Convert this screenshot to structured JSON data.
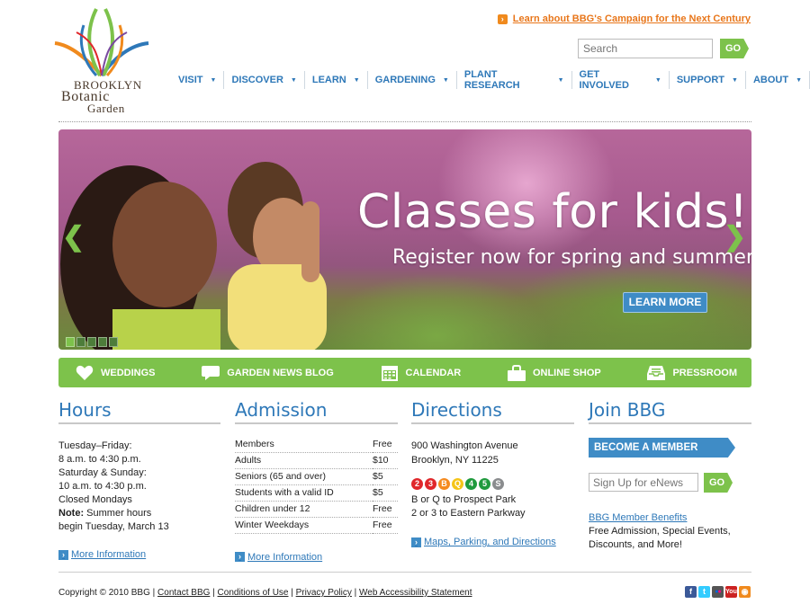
{
  "logo": {
    "line1": "Brooklyn",
    "line2": "Botanic",
    "line3": "Garden"
  },
  "header": {
    "campaign_link": "Learn about BBG's Campaign for the Next Century",
    "search_placeholder": "Search",
    "search_button": "GO"
  },
  "nav": [
    {
      "label": "VISIT"
    },
    {
      "label": "DISCOVER"
    },
    {
      "label": "LEARN"
    },
    {
      "label": "GARDENING"
    },
    {
      "label": "PLANT RESEARCH"
    },
    {
      "label": "GET INVOLVED"
    },
    {
      "label": "SUPPORT"
    },
    {
      "label": "ABOUT"
    }
  ],
  "hero": {
    "title": "Classes for kids!",
    "subtitle": "Register now for spring and summer.",
    "button": "LEARN MORE",
    "slides": 5,
    "active_slide": 1
  },
  "quicklinks": [
    {
      "label": "WEDDINGS",
      "icon": "heart-icon"
    },
    {
      "label": "GARDEN NEWS BLOG",
      "icon": "speech-bubble-icon"
    },
    {
      "label": "CALENDAR",
      "icon": "calendar-icon"
    },
    {
      "label": "ONLINE SHOP",
      "icon": "shopping-bag-icon"
    },
    {
      "label": "PRESSROOM",
      "icon": "inbox-tray-icon"
    }
  ],
  "hours": {
    "title": "Hours",
    "lines": [
      "Tuesday–Friday:",
      "8 a.m. to 4:30 p.m.",
      "Saturday & Sunday:",
      "10 a.m. to 4:30 p.m.",
      "Closed Mondays"
    ],
    "note_label": "Note:",
    "note_text": " Summer hours",
    "note_line2": "begin Tuesday, March 13",
    "more": "More Information"
  },
  "admission": {
    "title": "Admission",
    "rows": [
      {
        "label": "Members",
        "price": "Free"
      },
      {
        "label": "Adults",
        "price": "$10"
      },
      {
        "label": "Seniors (65 and over)",
        "price": "$5"
      },
      {
        "label": "Students with a valid ID",
        "price": "$5"
      },
      {
        "label": "Children under 12",
        "price": "Free"
      },
      {
        "label": "Winter Weekdays",
        "price": "Free"
      }
    ],
    "more": "More Information"
  },
  "directions": {
    "title": "Directions",
    "address1": "900 Washington Avenue",
    "address2": "Brooklyn, NY 11225",
    "subway": [
      {
        "line": "2",
        "color": "#e0272b"
      },
      {
        "line": "3",
        "color": "#e0272b"
      },
      {
        "line": "B",
        "color": "#f58a1f"
      },
      {
        "line": "Q",
        "color": "#f5c518"
      },
      {
        "line": "4",
        "color": "#1f9a3d"
      },
      {
        "line": "5",
        "color": "#1f9a3d"
      },
      {
        "line": "S",
        "color": "#8a8c8e"
      }
    ],
    "route1": "B or Q to Prospect Park",
    "route2": "2 or 3 to Eastern Parkway",
    "more": "Maps, Parking, and Directions"
  },
  "join": {
    "title": "Join BBG",
    "member_button": "BECOME A MEMBER",
    "enews_placeholder": "Sign Up for eNews",
    "enews_button": "GO",
    "benefits_link": "BBG Member Benefits",
    "benefits_text": "Free Admission, Special Events, Discounts, and More!"
  },
  "footer": {
    "copyright": "Copyright © 2010 BBG | ",
    "links": [
      "Contact BBG",
      "Conditions of Use",
      "Privacy Policy",
      "Web Accessibility Statement"
    ],
    "separator": " | ",
    "social": [
      {
        "name": "facebook-icon",
        "glyph": "f",
        "color": "#3b5998"
      },
      {
        "name": "twitter-icon",
        "glyph": "t",
        "color": "#33ccff"
      },
      {
        "name": "flickr-icon",
        "glyph": "••",
        "color": "#555"
      },
      {
        "name": "youtube-icon",
        "glyph": "Y",
        "color": "#cc2222"
      },
      {
        "name": "rss-icon",
        "glyph": "◉",
        "color": "#f08a1d"
      }
    ]
  }
}
